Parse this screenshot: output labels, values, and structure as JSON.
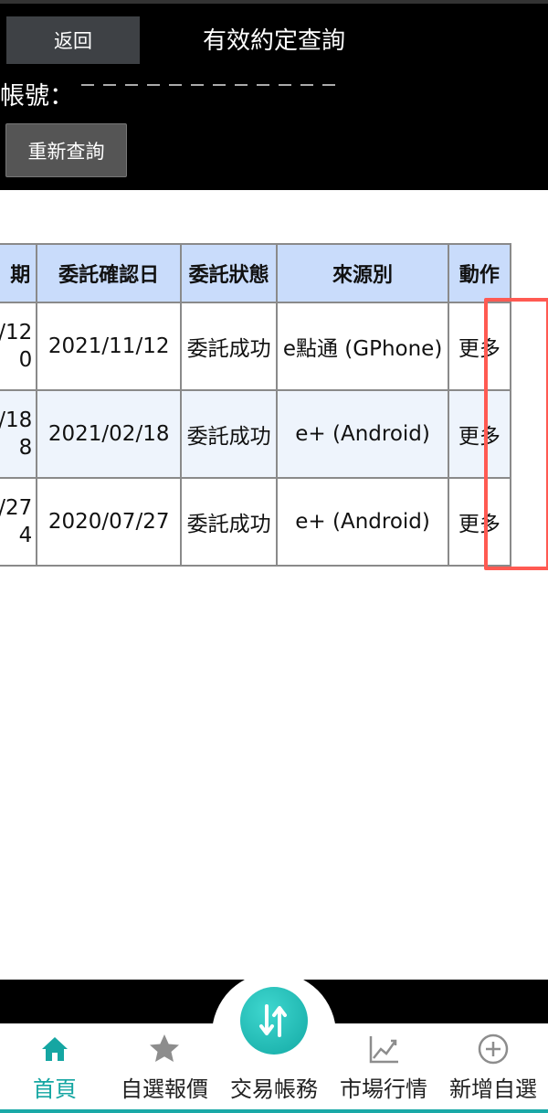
{
  "header": {
    "back_label": "返回",
    "title": "有效約定查詢",
    "account_label": "帳號：",
    "requery_label": "重新查詢"
  },
  "table": {
    "headers": [
      "期",
      "委託確認日",
      "委託狀態",
      "來源別",
      "動作"
    ],
    "rows": [
      {
        "date_top": "/12",
        "date_bottom": "0",
        "confirm_date": "2021/11/12",
        "status": "委託成功",
        "source": "e點通 (GPhone)",
        "action": "更多"
      },
      {
        "date_top": "/18",
        "date_bottom": "8",
        "confirm_date": "2021/02/18",
        "status": "委託成功",
        "source": "e+ (Android)",
        "action": "更多"
      },
      {
        "date_top": "/27",
        "date_bottom": "4",
        "confirm_date": "2020/07/27",
        "status": "委託成功",
        "source": "e+ (Android)",
        "action": "更多"
      }
    ]
  },
  "tabs": [
    {
      "label": "首頁",
      "icon": "home-icon",
      "active": true
    },
    {
      "label": "自選報價",
      "icon": "star-icon",
      "active": false
    },
    {
      "label": "交易帳務",
      "icon": "transfer-icon",
      "active": false
    },
    {
      "label": "市場行情",
      "icon": "chart-icon",
      "active": false
    },
    {
      "label": "新增自選",
      "icon": "plus-circle-icon",
      "active": false
    }
  ],
  "colors": {
    "accent": "#15a6a2",
    "header_bg": "#000000",
    "table_header_bg": "#c9dcfb",
    "highlight": "#ff5a52"
  }
}
